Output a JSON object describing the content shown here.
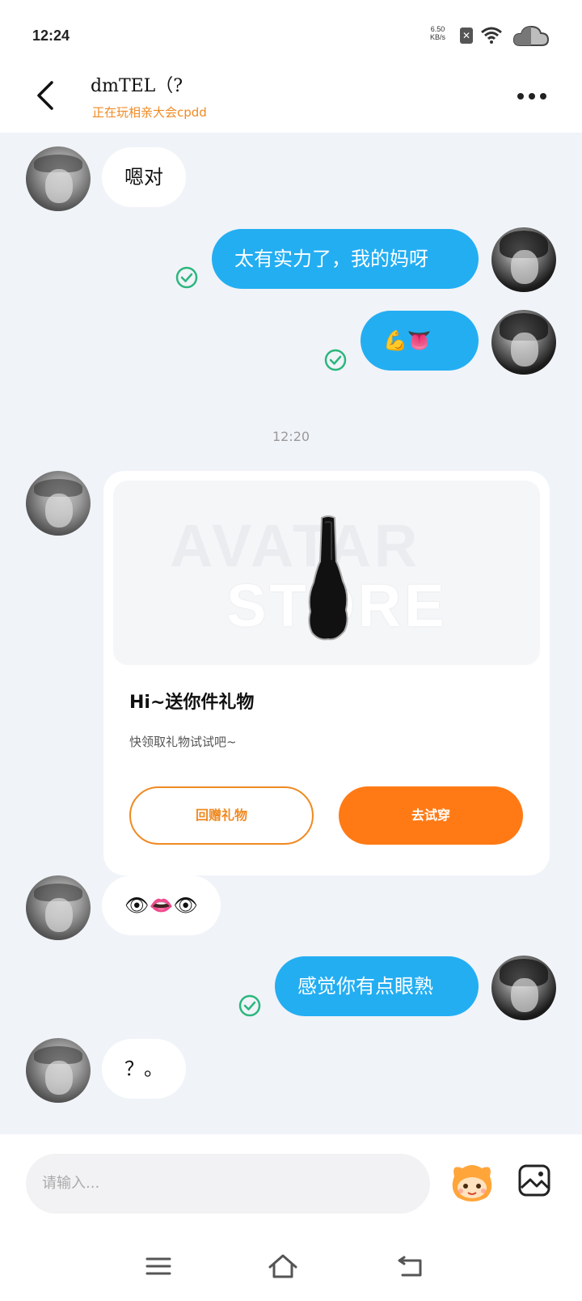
{
  "status_bar": {
    "time": "12:24",
    "net_speed_value": "6.50",
    "net_speed_unit": "KB/s"
  },
  "header": {
    "title": "dmTEL（?",
    "subtitle": "正在玩相亲大会cpdd"
  },
  "messages": [
    {
      "side": "in",
      "text": "嗯对"
    },
    {
      "side": "out",
      "text": "太有实力了，我的妈呀",
      "status": "read"
    },
    {
      "side": "out",
      "text": "💪👅",
      "status": "read"
    },
    {
      "side": "in",
      "text": "👁👄👁"
    },
    {
      "side": "out",
      "text": "感觉你有点眼熟",
      "status": "read"
    },
    {
      "side": "in",
      "text": "？。"
    }
  ],
  "timestamp": "12:20",
  "gift_card": {
    "banner_watermark_1": "AVATAR",
    "banner_watermark_2": "STORE",
    "title": "Hi~送你件礼物",
    "description": "快领取礼物试试吧~",
    "return_gift_label": "回赠礼物",
    "try_on_label": "去试穿"
  },
  "input": {
    "placeholder": "请输入..."
  },
  "colors": {
    "outgoing_bubble": "#23aef2",
    "accent_orange": "#ff7a15",
    "subtitle_orange": "#f08a22",
    "read_check": "#2cb67d",
    "background": "#f0f3f8"
  },
  "icons": {
    "back": "chevron-left-icon",
    "more": "more-dots-icon",
    "read": "check-circle-icon",
    "gift_item": "guitar-case-icon",
    "sticker": "mascot-icon",
    "image": "image-icon",
    "nav_menu": "menu-icon",
    "nav_home": "home-icon",
    "nav_back": "back-arrow-icon"
  }
}
